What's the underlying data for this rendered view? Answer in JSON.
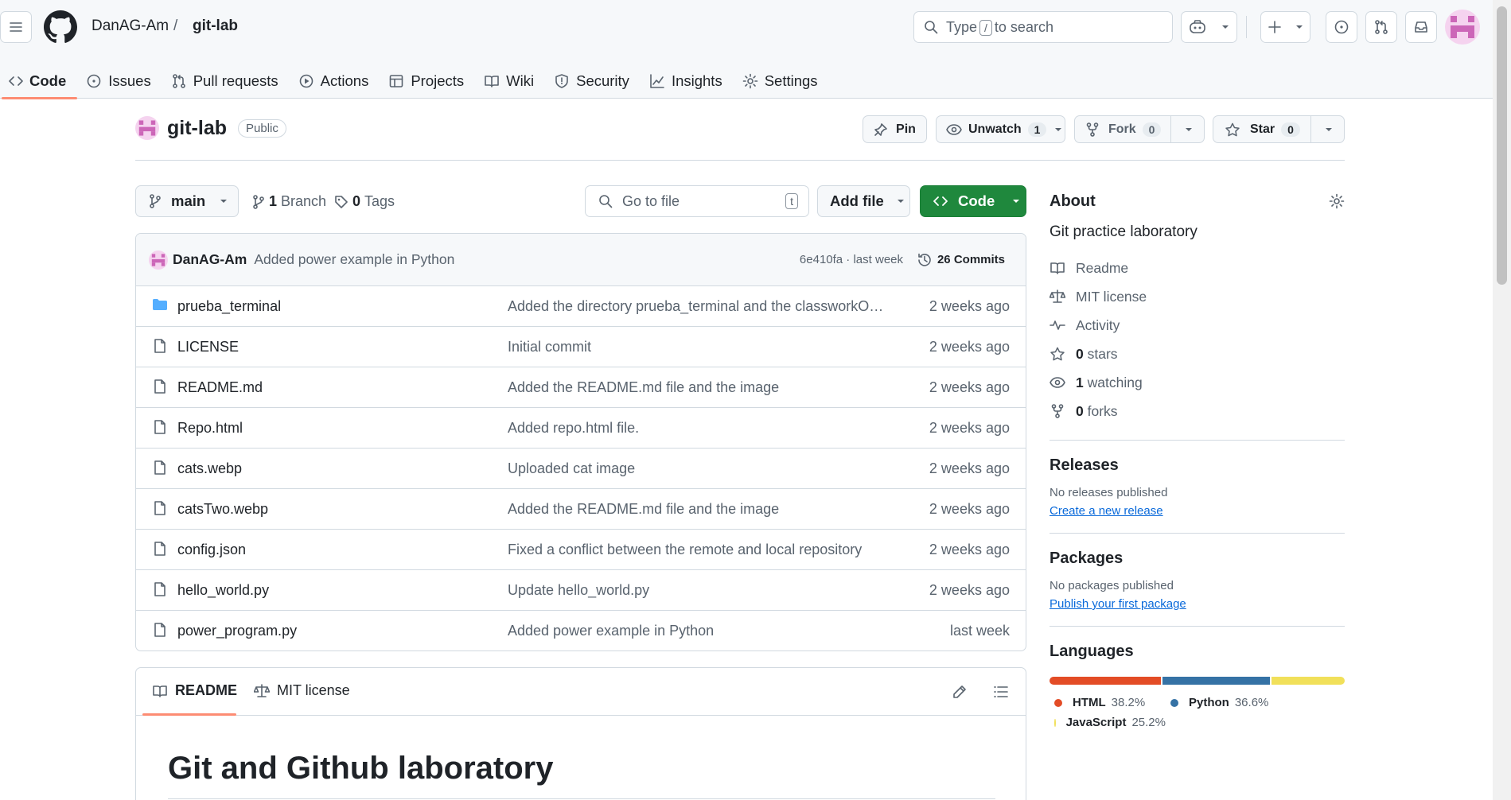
{
  "header": {
    "owner": "DanAG-Am",
    "separator": "/",
    "repo": "git-lab",
    "search_prefix": "Type",
    "search_key": "/",
    "search_suffix": "to search"
  },
  "nav": {
    "tabs": [
      {
        "label": "Code",
        "icon": "code-icon",
        "active": true
      },
      {
        "label": "Issues",
        "icon": "issue-icon"
      },
      {
        "label": "Pull requests",
        "icon": "pull-request-icon"
      },
      {
        "label": "Actions",
        "icon": "play-icon"
      },
      {
        "label": "Projects",
        "icon": "table-icon"
      },
      {
        "label": "Wiki",
        "icon": "book-icon"
      },
      {
        "label": "Security",
        "icon": "shield-icon"
      },
      {
        "label": "Insights",
        "icon": "graph-icon"
      },
      {
        "label": "Settings",
        "icon": "gear-icon"
      }
    ]
  },
  "repo_header": {
    "name": "git-lab",
    "visibility": "Public",
    "pin_label": "Pin",
    "unwatch_label": "Unwatch",
    "unwatch_count": "1",
    "fork_label": "Fork",
    "fork_count": "0",
    "star_label": "Star",
    "star_count": "0"
  },
  "toolbar": {
    "branch": "main",
    "branches_count": "1",
    "branches_label": "Branch",
    "tags_count": "0",
    "tags_label": "Tags",
    "go_to_file_placeholder": "Go to file",
    "go_to_file_key": "t",
    "add_file_label": "Add file",
    "code_label": "Code"
  },
  "latest_commit": {
    "author": "DanAG-Am",
    "message": "Added power example in Python",
    "hash_time": "6e410fa · last week",
    "commits_count": "26 Commits"
  },
  "files": [
    {
      "name": "prueba_terminal",
      "type": "folder",
      "message": "Added the directory prueba_terminal and the classworkOne …",
      "time": "2 weeks ago"
    },
    {
      "name": "LICENSE",
      "type": "file",
      "message": "Initial commit",
      "time": "2 weeks ago"
    },
    {
      "name": "README.md",
      "type": "file",
      "message": "Added the README.md file and the image",
      "time": "2 weeks ago"
    },
    {
      "name": "Repo.html",
      "type": "file",
      "message": "Added repo.html file.",
      "time": "2 weeks ago"
    },
    {
      "name": "cats.webp",
      "type": "file",
      "message": "Uploaded cat image",
      "time": "2 weeks ago"
    },
    {
      "name": "catsTwo.webp",
      "type": "file",
      "message": "Added the README.md file and the image",
      "time": "2 weeks ago"
    },
    {
      "name": "config.json",
      "type": "file",
      "message": "Fixed a conflict between the remote and local repository",
      "time": "2 weeks ago"
    },
    {
      "name": "hello_world.py",
      "type": "file",
      "message": "Update hello_world.py",
      "time": "2 weeks ago"
    },
    {
      "name": "power_program.py",
      "type": "file",
      "message": "Added power example in Python",
      "time": "last week"
    }
  ],
  "readme": {
    "tab_readme": "README",
    "tab_license": "MIT license",
    "heading": "Git and Github laboratory"
  },
  "about": {
    "title": "About",
    "description": "Git practice laboratory",
    "readme": "Readme",
    "license": "MIT license",
    "activity": "Activity",
    "stars_count": "0",
    "stars_label": "stars",
    "watching_count": "1",
    "watching_label": "watching",
    "forks_count": "0",
    "forks_label": "forks"
  },
  "releases": {
    "title": "Releases",
    "empty": "No releases published",
    "link": "Create a new release"
  },
  "packages": {
    "title": "Packages",
    "empty": "No packages published",
    "link": "Publish your first package"
  },
  "languages": {
    "title": "Languages",
    "items": [
      {
        "name": "HTML",
        "percent": "38.2%",
        "value": 38.2,
        "color": "#e34c26"
      },
      {
        "name": "Python",
        "percent": "36.6%",
        "value": 36.6,
        "color": "#3572A5"
      },
      {
        "name": "JavaScript",
        "percent": "25.2%",
        "value": 25.2,
        "color": "#f1e05a"
      }
    ]
  }
}
